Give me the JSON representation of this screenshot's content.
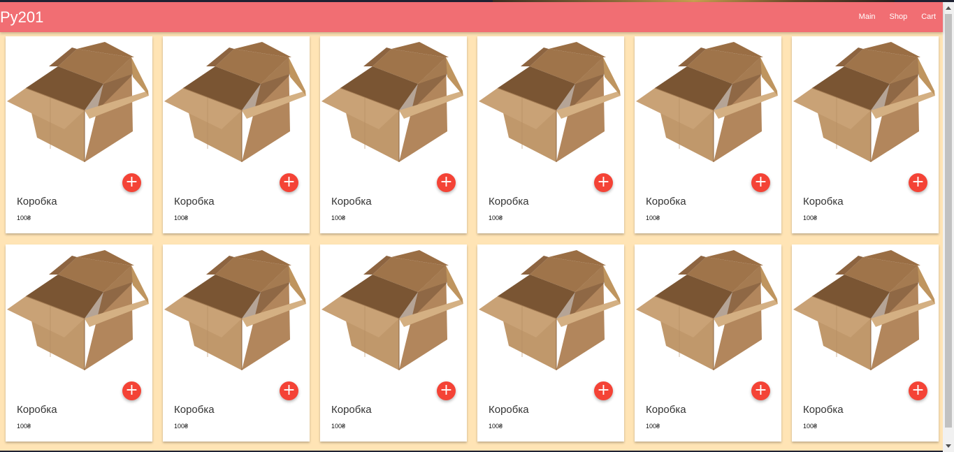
{
  "navbar": {
    "brand": "Py201",
    "links": [
      {
        "label": "Main"
      },
      {
        "label": "Shop"
      },
      {
        "label": "Cart"
      }
    ]
  },
  "products": [
    {
      "title": "Коробка",
      "price": "100₴"
    },
    {
      "title": "Коробка",
      "price": "100₴"
    },
    {
      "title": "Коробка",
      "price": "100₴"
    },
    {
      "title": "Коробка",
      "price": "100₴"
    },
    {
      "title": "Коробка",
      "price": "100₴"
    },
    {
      "title": "Коробка",
      "price": "100₴"
    },
    {
      "title": "Коробка",
      "price": "100₴"
    },
    {
      "title": "Коробка",
      "price": "100₴"
    },
    {
      "title": "Коробка",
      "price": "100₴"
    },
    {
      "title": "Коробка",
      "price": "100₴"
    },
    {
      "title": "Коробка",
      "price": "100₴"
    },
    {
      "title": "Коробка",
      "price": "100₴"
    }
  ],
  "add_button_icon": "plus-icon",
  "product_image": "cardboard-box-image",
  "colors": {
    "navbar": "#f16e73",
    "background": "#ffe4b5",
    "fab": "#f44336"
  }
}
